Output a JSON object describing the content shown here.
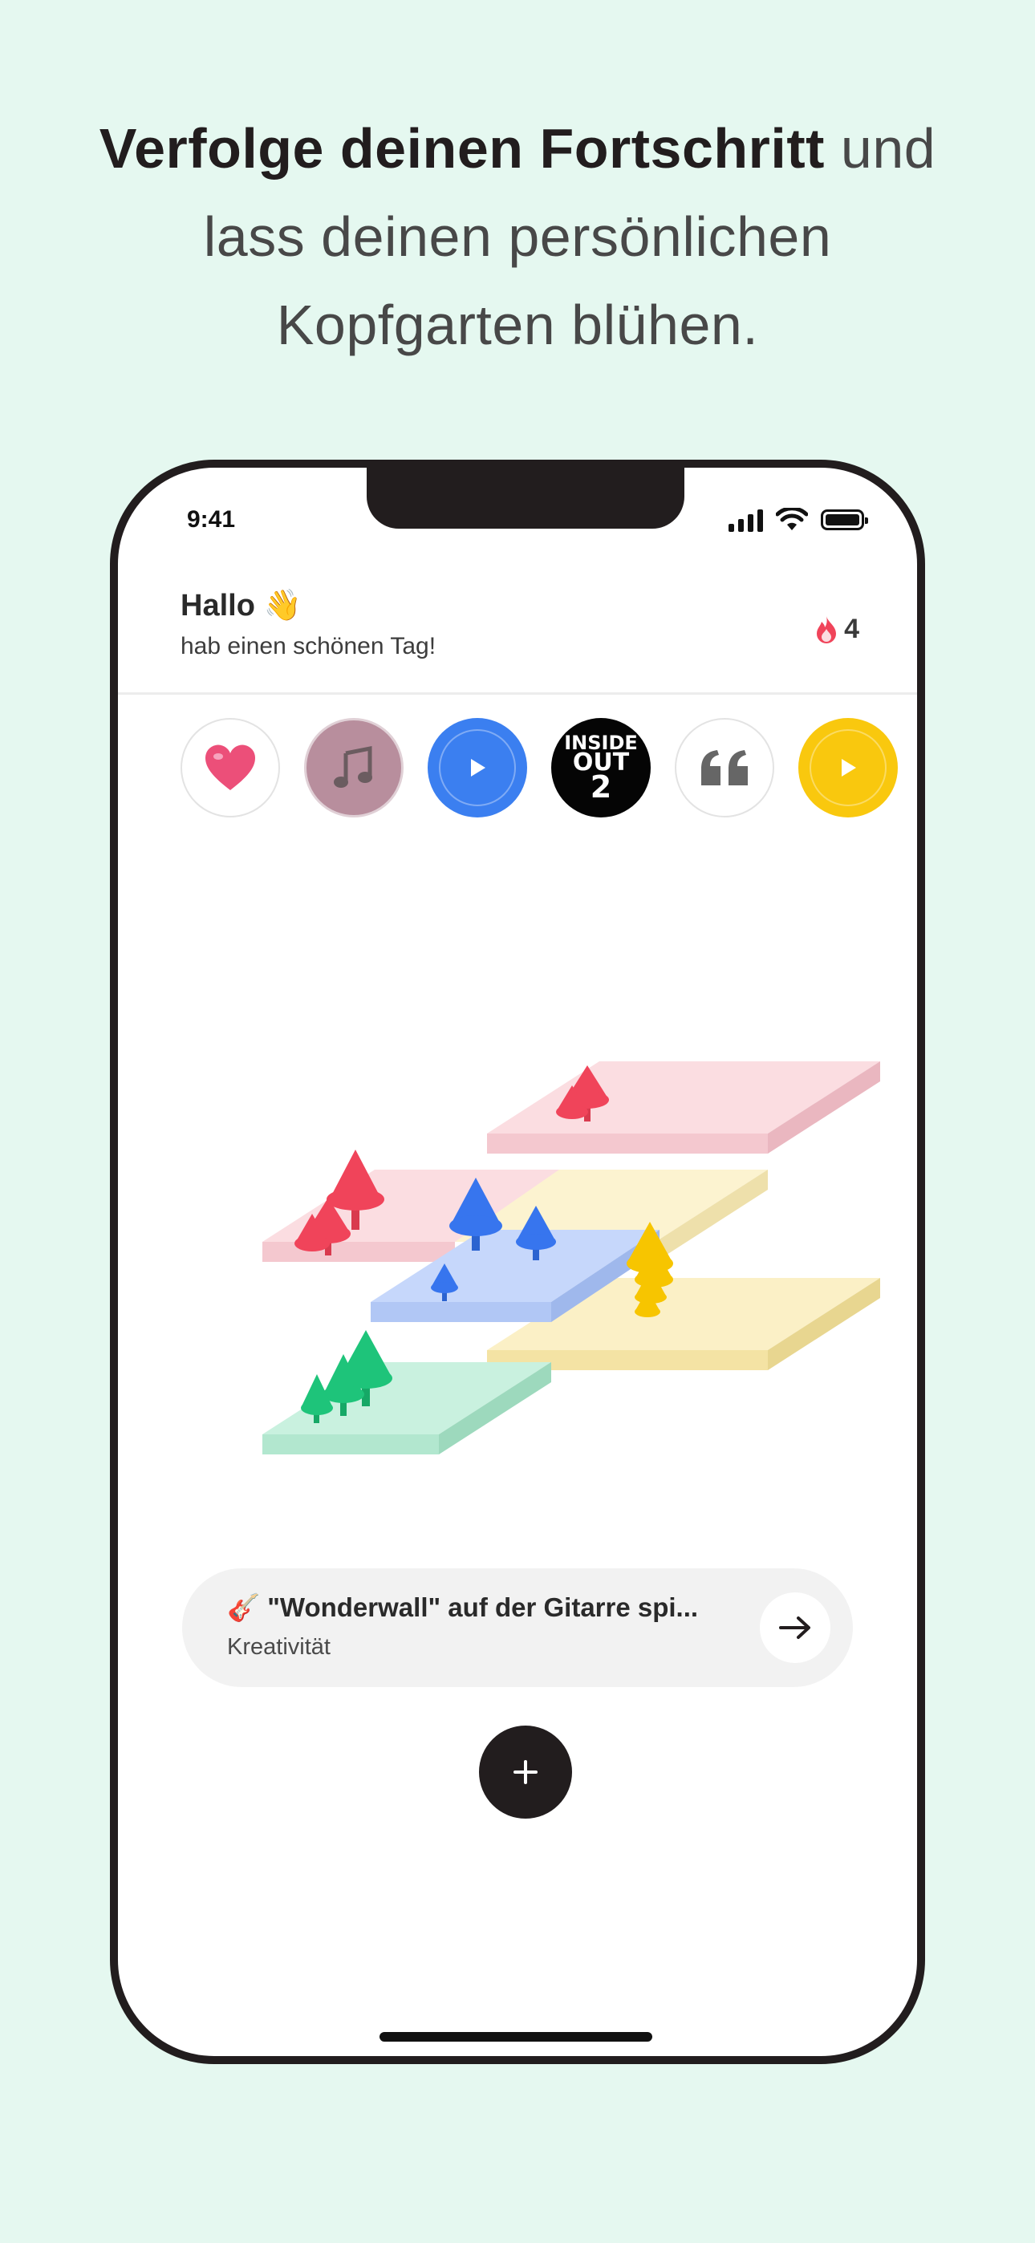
{
  "headline": {
    "bold": "Verfolge deinen Fortschritt",
    "rest_line1": " und",
    "line2": "lass deinen persönlichen",
    "line3": "Kopfgarten blühen."
  },
  "status_bar": {
    "time": "9:41"
  },
  "header": {
    "greeting": "Hallo",
    "greeting_emoji": "👋",
    "subtitle": "hab einen schönen Tag!",
    "streak_count": "4",
    "streak_icon": "flame-icon"
  },
  "stories": [
    {
      "kind": "heart",
      "icon": "heart-icon"
    },
    {
      "kind": "music",
      "icon": "music-note-icon"
    },
    {
      "kind": "video",
      "icon": "play-icon",
      "color": "#3b7ff0"
    },
    {
      "kind": "movie",
      "label_lines": [
        "INSIDE",
        "OUT",
        "2"
      ]
    },
    {
      "kind": "quote",
      "icon": "quote-icon"
    },
    {
      "kind": "video",
      "icon": "play-icon",
      "color": "#f9c80e"
    }
  ],
  "garden": {
    "tile_colors": {
      "red": "#fbdde1",
      "yellow": "#fcf3d0",
      "blue": "#c6d7fb",
      "green": "#c9f1df",
      "yellow2": "#fbf0c6",
      "pink": "#fbdde1"
    },
    "tree_colors": {
      "red": "#f0445a",
      "blue": "#3775ee",
      "yellow": "#f7c500",
      "green": "#1ec47a"
    }
  },
  "task": {
    "emoji": "🎸",
    "title": "\"Wonderwall\" auf der Gitarre spi...",
    "category": "Kreativität"
  },
  "colors": {
    "background": "#e5f8f0",
    "dark": "#221d1e",
    "card": "#f2f2f2"
  }
}
